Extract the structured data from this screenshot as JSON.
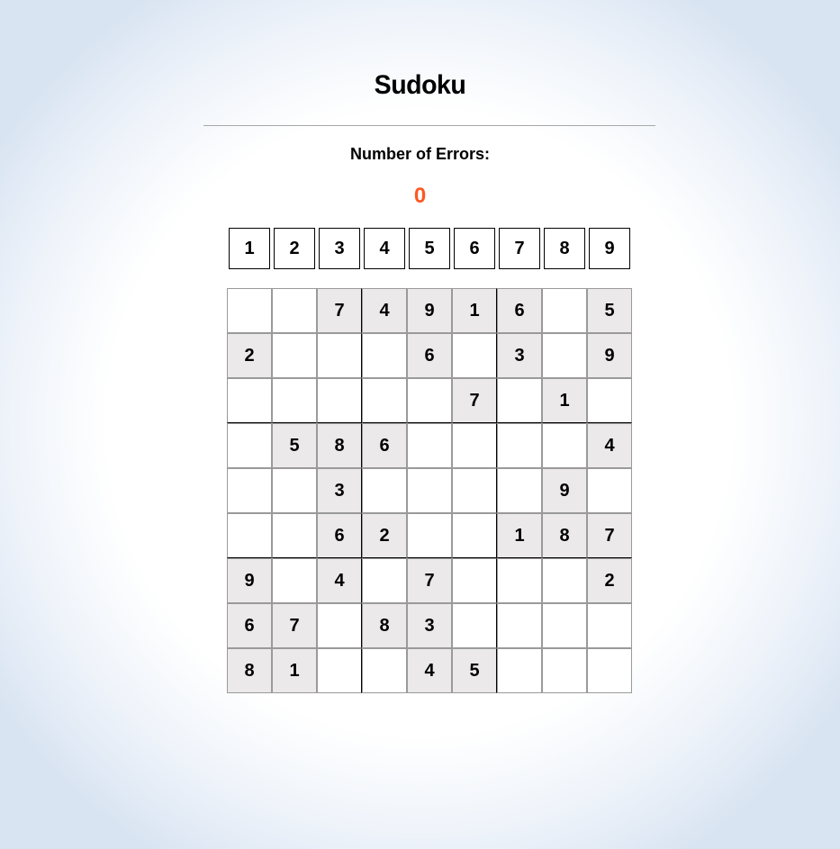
{
  "title": "Sudoku",
  "errors": {
    "label": "Number of Errors:",
    "value": "0"
  },
  "colors": {
    "error_value": "#ff5722",
    "given_cell": "#ebe9e9",
    "empty_cell": "#ffffff"
  },
  "digits": [
    "1",
    "2",
    "3",
    "4",
    "5",
    "6",
    "7",
    "8",
    "9"
  ],
  "board": [
    [
      "",
      "",
      "7",
      "4",
      "9",
      "1",
      "6",
      "",
      "5"
    ],
    [
      "2",
      "",
      "",
      "",
      "6",
      "",
      "3",
      "",
      "9"
    ],
    [
      "",
      "",
      "",
      "",
      "",
      "7",
      "",
      "1",
      ""
    ],
    [
      "",
      "5",
      "8",
      "6",
      "",
      "",
      "",
      "",
      "4"
    ],
    [
      "",
      "",
      "3",
      "",
      "",
      "",
      "",
      "9",
      ""
    ],
    [
      "",
      "",
      "6",
      "2",
      "",
      "",
      "1",
      "8",
      "7"
    ],
    [
      "9",
      "",
      "4",
      "",
      "7",
      "",
      "",
      "",
      "2"
    ],
    [
      "6",
      "7",
      "",
      "8",
      "3",
      "",
      "",
      "",
      ""
    ],
    [
      "8",
      "1",
      "",
      "",
      "4",
      "5",
      "",
      "",
      ""
    ]
  ]
}
